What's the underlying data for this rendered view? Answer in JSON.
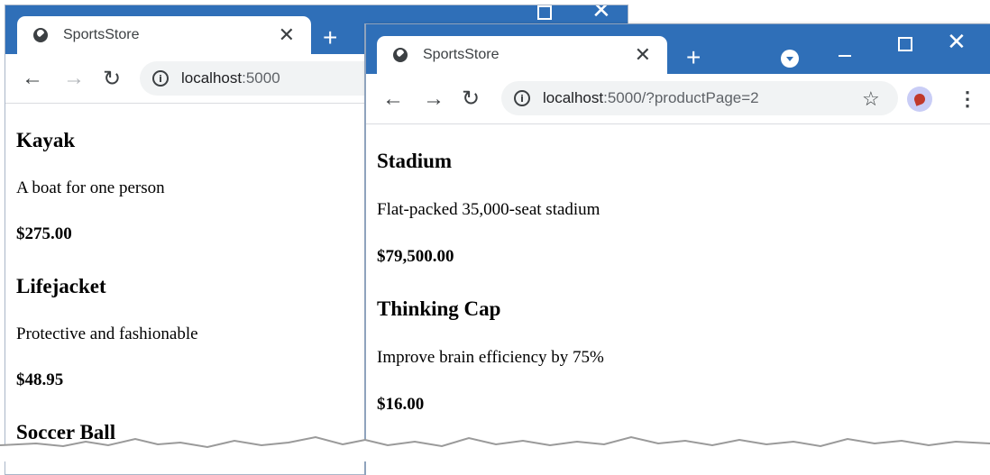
{
  "windows": [
    {
      "tab_title": "SportsStore",
      "url_host": "localhost",
      "url_rest": ":5000",
      "products": [
        {
          "name": "Kayak",
          "description": "A boat for one person",
          "price": "$275.00"
        },
        {
          "name": "Lifejacket",
          "description": "Protective and fashionable",
          "price": "$48.95"
        },
        {
          "name": "Soccer Ball",
          "description": "",
          "price": ""
        }
      ]
    },
    {
      "tab_title": "SportsStore",
      "url_host": "localhost",
      "url_rest": ":5000/?productPage=2",
      "products": [
        {
          "name": "Stadium",
          "description": "Flat-packed 35,000-seat stadium",
          "price": "$79,500.00"
        },
        {
          "name": "Thinking Cap",
          "description": "Improve brain efficiency by 75%",
          "price": "$16.00"
        }
      ]
    }
  ],
  "colors": {
    "tabstrip": "#2f6fb8",
    "omnibox": "#f1f3f4"
  },
  "icons": {
    "tab_icon": "globe-icon",
    "close": "close-icon",
    "new_tab": "plus-icon",
    "back": "arrow-left-icon",
    "forward": "arrow-right-icon",
    "reload": "reload-icon",
    "info": "info-icon",
    "bookmark": "star-icon",
    "menu": "kebab-icon",
    "profile": "profile-icon",
    "minimize": "minimize-icon",
    "maximize": "maximize-icon",
    "window_close": "window-close-icon"
  }
}
